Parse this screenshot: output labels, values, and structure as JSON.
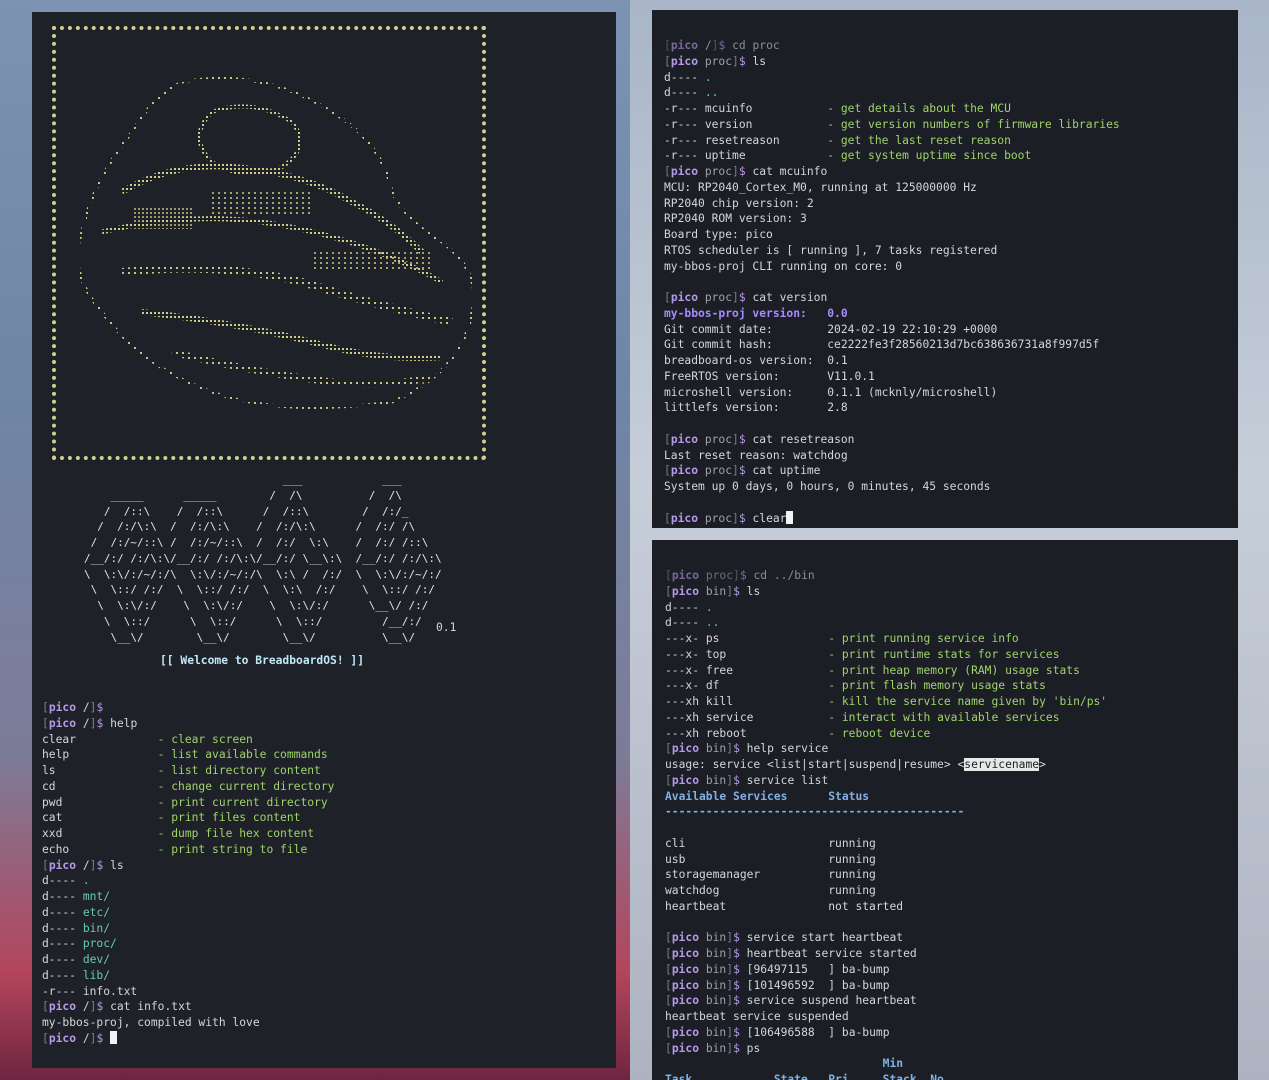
{
  "left_terminal": {
    "welcome": "[[ Welcome to BreadboardOS! ]]",
    "version": "0.1",
    "logo_ascii": [
      "                              ___            ___",
      "    _____      _____        /  /\\          /  /\\",
      "   /  /::\\    /  /::\\      /  /::\\        /  /:/_",
      "  /  /:/\\:\\  /  /:/\\:\\    /  /:/\\:\\      /  /:/ /\\",
      " /  /:/~/::\\ /  /:/~/::\\  /  /:/  \\:\\    /  /:/ /::\\",
      "/__/:/ /:/\\:\\/__/:/ /:/\\:\\/__/:/ \\__\\:\\  /__/:/ /:/\\:\\",
      "\\  \\:\\/:/~/:/\\  \\:\\/:/~/:/\\  \\:\\ /  /:/  \\  \\:\\/:/~/:/",
      " \\  \\::/ /:/  \\  \\::/ /:/  \\  \\:\\  /:/    \\  \\::/ /:/",
      "  \\  \\:\\/:/    \\  \\:\\/:/    \\  \\:\\/:/      \\__\\/ /:/",
      "   \\  \\::/      \\  \\::/      \\  \\::/         /__/:/",
      "    \\__\\/        \\__\\/        \\__\\/          \\__\\/"
    ],
    "prompt_host": "pico",
    "lines": [
      {
        "kind": "prompt",
        "path": "/",
        "cmd": ""
      },
      {
        "kind": "prompt",
        "path": "/",
        "cmd": "help"
      },
      {
        "kind": "help",
        "name": "clear",
        "desc": "- clear screen"
      },
      {
        "kind": "help",
        "name": "help",
        "desc": "- list available commands"
      },
      {
        "kind": "help",
        "name": "ls",
        "desc": "- list directory content"
      },
      {
        "kind": "help",
        "name": "cd",
        "desc": "- change current directory"
      },
      {
        "kind": "help",
        "name": "pwd",
        "desc": "- print current directory"
      },
      {
        "kind": "help",
        "name": "cat",
        "desc": "- print files content"
      },
      {
        "kind": "help",
        "name": "xxd",
        "desc": "- dump file hex content"
      },
      {
        "kind": "help",
        "name": "echo",
        "desc": "- print string to file"
      },
      {
        "kind": "prompt",
        "path": "/",
        "cmd": "ls"
      },
      {
        "kind": "entry",
        "perm": "d----",
        "name": ".",
        "dir": false
      },
      {
        "kind": "entry",
        "perm": "d----",
        "name": "mnt/",
        "dir": true
      },
      {
        "kind": "entry",
        "perm": "d----",
        "name": "etc/",
        "dir": true
      },
      {
        "kind": "entry",
        "perm": "d----",
        "name": "bin/",
        "dir": true
      },
      {
        "kind": "entry",
        "perm": "d----",
        "name": "proc/",
        "dir": true
      },
      {
        "kind": "entry",
        "perm": "d----",
        "name": "dev/",
        "dir": true
      },
      {
        "kind": "entry",
        "perm": "d----",
        "name": "lib/",
        "dir": true
      },
      {
        "kind": "entry",
        "perm": "-r---",
        "name": "info.txt",
        "dir": false
      },
      {
        "kind": "prompt",
        "path": "/",
        "cmd": "cat info.txt"
      },
      {
        "kind": "text",
        "text": "my-bbos-proj, compiled with love"
      },
      {
        "kind": "prompt",
        "path": "/",
        "cmd": "",
        "cursor": true
      }
    ]
  },
  "top_right_terminal": {
    "lines": [
      {
        "kind": "prompt",
        "path": "/",
        "cmd": "cd proc",
        "dim": true
      },
      {
        "kind": "prompt",
        "path": "proc",
        "cmd": "ls"
      },
      {
        "kind": "entry",
        "perm": "d----",
        "name": ".",
        "dir": false
      },
      {
        "kind": "entry",
        "perm": "d----",
        "name": "..",
        "dir": false
      },
      {
        "kind": "entry",
        "perm": "-r---",
        "name": "mcuinfo",
        "desc": "- get details about the MCU"
      },
      {
        "kind": "entry",
        "perm": "-r---",
        "name": "version",
        "desc": "- get version numbers of firmware libraries"
      },
      {
        "kind": "entry",
        "perm": "-r---",
        "name": "resetreason",
        "desc": "- get the last reset reason"
      },
      {
        "kind": "entry",
        "perm": "-r---",
        "name": "uptime",
        "desc": "- get system uptime since boot"
      },
      {
        "kind": "prompt",
        "path": "proc",
        "cmd": "cat mcuinfo"
      },
      {
        "kind": "text",
        "text": "MCU: RP2040_Cortex_M0, running at 125000000 Hz"
      },
      {
        "kind": "text",
        "text": "RP2040 chip version: 2"
      },
      {
        "kind": "text",
        "text": "RP2040 ROM version: 3"
      },
      {
        "kind": "text",
        "text": "Board type: pico"
      },
      {
        "kind": "text",
        "text": "RTOS scheduler is [ running ], 7 tasks registered"
      },
      {
        "kind": "text",
        "text": "my-bbos-proj CLI running on core: 0"
      },
      {
        "kind": "blank"
      },
      {
        "kind": "prompt",
        "path": "proc",
        "cmd": "cat version"
      },
      {
        "kind": "kv",
        "key": "my-bbos-proj version:",
        "value": "0.0",
        "accent": true
      },
      {
        "kind": "kv",
        "key": "Git commit date:",
        "value": "2024-02-19 22:10:29 +0000"
      },
      {
        "kind": "kv",
        "key": "Git commit hash:",
        "value": "ce2222fe3f28560213d7bc638636731a8f997d5f"
      },
      {
        "kind": "kv",
        "key": "breadboard-os version:",
        "value": "0.1"
      },
      {
        "kind": "kv",
        "key": "FreeRTOS version:",
        "value": "V11.0.1"
      },
      {
        "kind": "kv",
        "key": "microshell version:",
        "value": "0.1.1 (mcknly/microshell)"
      },
      {
        "kind": "kv",
        "key": "littlefs version:",
        "value": "2.8"
      },
      {
        "kind": "blank"
      },
      {
        "kind": "prompt",
        "path": "proc",
        "cmd": "cat resetreason"
      },
      {
        "kind": "text",
        "text": "Last reset reason: watchdog"
      },
      {
        "kind": "prompt",
        "path": "proc",
        "cmd": "cat uptime"
      },
      {
        "kind": "text",
        "text": "System up 0 days, 0 hours, 0 minutes, 45 seconds"
      },
      {
        "kind": "blank"
      },
      {
        "kind": "prompt",
        "path": "proc",
        "cmd": "clear",
        "cursor": true
      }
    ]
  },
  "bottom_right_terminal": {
    "lines": [
      {
        "kind": "prompt",
        "path": "proc",
        "cmd": "cd ../bin",
        "dim": true
      },
      {
        "kind": "prompt",
        "path": "bin",
        "cmd": "ls"
      },
      {
        "kind": "entry",
        "perm": "d----",
        "name": ".",
        "dir": false
      },
      {
        "kind": "entry",
        "perm": "d----",
        "name": "..",
        "dir": false
      },
      {
        "kind": "entry",
        "perm": "---x-",
        "name": "ps",
        "desc": "- print running service info"
      },
      {
        "kind": "entry",
        "perm": "---x-",
        "name": "top",
        "desc": "- print runtime stats for services"
      },
      {
        "kind": "entry",
        "perm": "---x-",
        "name": "free",
        "desc": "- print heap memory (RAM) usage stats"
      },
      {
        "kind": "entry",
        "perm": "---x-",
        "name": "df",
        "desc": "- print flash memory usage stats"
      },
      {
        "kind": "entry",
        "perm": "---xh",
        "name": "kill",
        "desc": "- kill the service name given by 'bin/ps'"
      },
      {
        "kind": "entry",
        "perm": "---xh",
        "name": "service",
        "desc": "- interact with available services"
      },
      {
        "kind": "entry",
        "perm": "---xh",
        "name": "reboot",
        "desc": "- reboot device"
      },
      {
        "kind": "prompt",
        "path": "bin",
        "cmd": "help service"
      },
      {
        "kind": "usage",
        "text": "usage: service <list|start|suspend|resume> <",
        "hi": "servicename",
        "tail": ">"
      },
      {
        "kind": "prompt",
        "path": "bin",
        "cmd": "service list"
      },
      {
        "kind": "thead",
        "a": "Available Services",
        "b": "Status"
      },
      {
        "kind": "rule",
        "text": "--------------------------------------------"
      },
      {
        "kind": "blank"
      },
      {
        "kind": "svc",
        "name": "cli",
        "status": "running"
      },
      {
        "kind": "svc",
        "name": "usb",
        "status": "running"
      },
      {
        "kind": "svc",
        "name": "storagemanager",
        "status": "running"
      },
      {
        "kind": "svc",
        "name": "watchdog",
        "status": "running"
      },
      {
        "kind": "svc",
        "name": "heartbeat",
        "status": "not started"
      },
      {
        "kind": "blank"
      },
      {
        "kind": "prompt",
        "path": "bin",
        "cmd": "service start heartbeat"
      },
      {
        "kind": "prompt",
        "path": "bin",
        "cmd": "heartbeat service started"
      },
      {
        "kind": "prompt",
        "path": "bin",
        "cmd": "[96497115   ] ba-bump"
      },
      {
        "kind": "prompt",
        "path": "bin",
        "cmd": "[101496592  ] ba-bump"
      },
      {
        "kind": "prompt",
        "path": "bin",
        "cmd": "service suspend heartbeat"
      },
      {
        "kind": "text",
        "text": "heartbeat service suspended"
      },
      {
        "kind": "prompt",
        "path": "bin",
        "cmd": "[106496588  ] ba-bump"
      },
      {
        "kind": "prompt",
        "path": "bin",
        "cmd": "ps"
      },
      {
        "kind": "pshead1",
        "text": "Min"
      },
      {
        "kind": "pshead2",
        "cols": [
          "Task",
          "State",
          "Pri",
          "Stack",
          "No"
        ]
      }
    ]
  }
}
